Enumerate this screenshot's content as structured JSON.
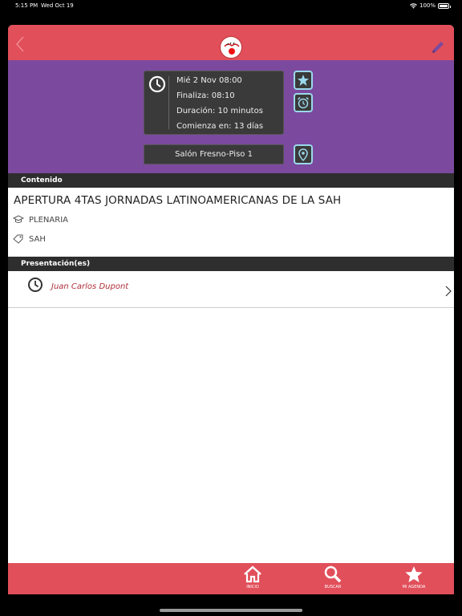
{
  "status": {
    "time": "5:15 PM",
    "date": "Wed Oct 19",
    "battery": "100%"
  },
  "colors": {
    "header": "#e14f5a",
    "purple": "#7b4a9e",
    "dark": "#3a3a3a",
    "accent": "#9ad8ec",
    "speaker": "#b0303a"
  },
  "nav": {
    "back_icon": "chevron-left-icon",
    "logo": "event-logo",
    "edit_icon": "pencil-icon"
  },
  "schedule": {
    "start": "Mié 2  Nov  08:00",
    "end": "Finaliza: 08:10",
    "duration": "Duración: 10 minutos",
    "starts_in": "Comienza en: 13 días",
    "room": "Salón Fresno-Piso 1"
  },
  "content": {
    "header": "Contenido",
    "title": "APERTURA 4TAS JORNADAS LATINOAMERICANAS DE LA SAH",
    "type": "PLENARIA",
    "tag": "SAH"
  },
  "presentations": {
    "header": "Presentación(es)",
    "items": [
      {
        "speaker": "Juan Carlos Dupont"
      }
    ]
  },
  "tabs": [
    {
      "label": "INICIO",
      "icon": "home-icon"
    },
    {
      "label": "BUSCAR",
      "icon": "search-icon"
    },
    {
      "label": "MI AGENDA",
      "icon": "star-icon"
    }
  ]
}
